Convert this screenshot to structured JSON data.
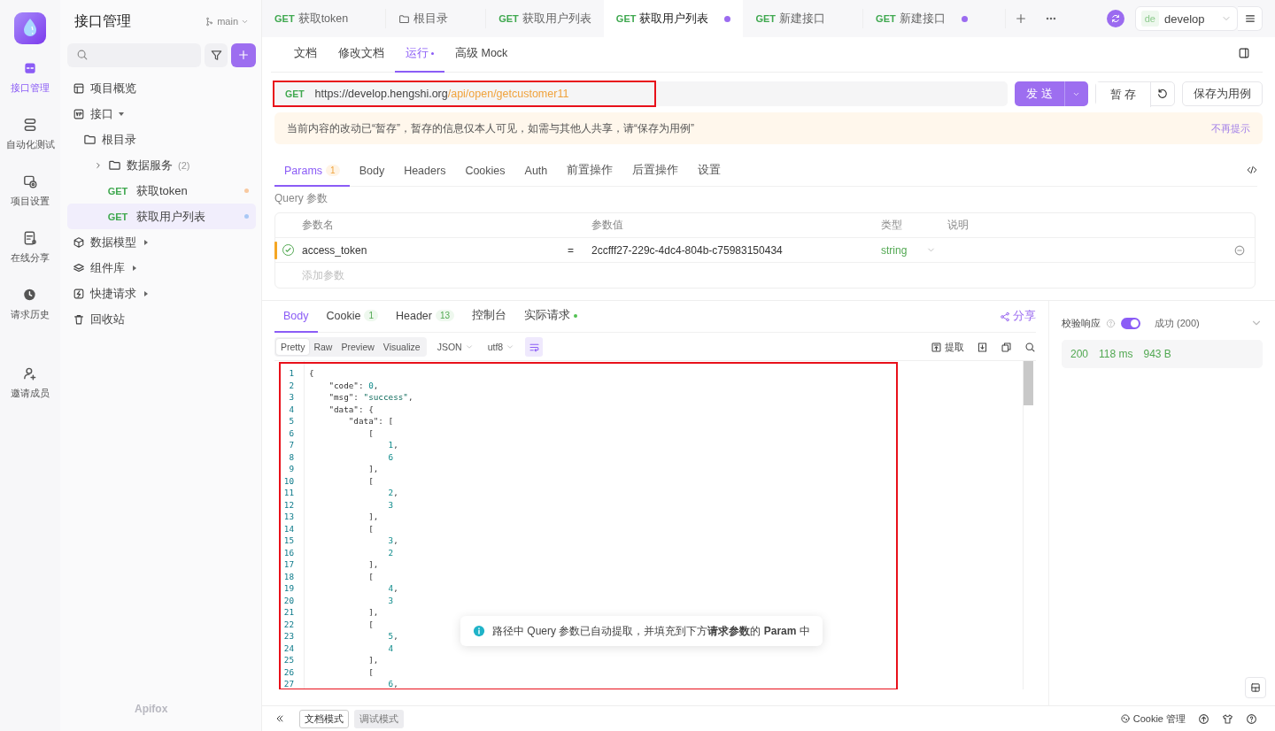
{
  "rail": {
    "items": [
      {
        "label": "接口管理",
        "selected": true
      },
      {
        "label": "自动化测试",
        "selected": false
      },
      {
        "label": "项目设置",
        "selected": false
      },
      {
        "label": "在线分享",
        "selected": false
      },
      {
        "label": "请求历史",
        "selected": false
      },
      {
        "label": "邀请成员",
        "selected": false
      }
    ]
  },
  "sidebar": {
    "title": "接口管理",
    "branch": "main",
    "brand": "Apifox",
    "tree": [
      {
        "kind": "group",
        "label": "项目概览",
        "selected": false
      },
      {
        "kind": "group",
        "label": "接口",
        "selected": false,
        "expanded": true,
        "children": [
          {
            "kind": "folder",
            "label": "根目录",
            "selected": false,
            "children": [
              {
                "kind": "folder",
                "label": "数据服务",
                "count": "(2)",
                "selected": false,
                "expanded": false
              },
              {
                "kind": "request",
                "method": "GET",
                "label": "获取token",
                "selected": false,
                "color": "#f8c9a0"
              },
              {
                "kind": "request",
                "method": "GET",
                "label": "获取用户列表",
                "selected": true,
                "color": "#a9c8f5"
              }
            ]
          }
        ]
      },
      {
        "kind": "group",
        "label": "数据模型",
        "selected": false,
        "expanded": false
      },
      {
        "kind": "group",
        "label": "组件库",
        "selected": false,
        "expanded": false
      },
      {
        "kind": "group",
        "label": "快捷请求",
        "selected": false,
        "expanded": false
      },
      {
        "kind": "group",
        "label": "回收站",
        "selected": false
      }
    ]
  },
  "tabs": [
    {
      "kind": "request",
      "method": "GET",
      "label": "获取token",
      "selected": false,
      "modified": false
    },
    {
      "kind": "folder",
      "label": "根目录",
      "selected": false,
      "modified": false
    },
    {
      "kind": "request",
      "method": "GET",
      "label": "获取用户列表",
      "selected": false,
      "modified": false
    },
    {
      "kind": "request",
      "method": "GET",
      "label": "获取用户列表",
      "selected": true,
      "modified": true
    },
    {
      "kind": "request",
      "method": "GET",
      "label": "新建接口",
      "selected": false,
      "modified": false
    },
    {
      "kind": "request",
      "method": "GET",
      "label": "新建接口",
      "selected": false,
      "modified": true
    }
  ],
  "environment": {
    "badge": "de",
    "name": "develop"
  },
  "subtabs": [
    {
      "label": "文档",
      "selected": false,
      "modified": false
    },
    {
      "label": "修改文档",
      "selected": false,
      "modified": false
    },
    {
      "label": "运行",
      "selected": true,
      "modified": true
    },
    {
      "label": "高级 Mock",
      "selected": false,
      "modified": false
    }
  ],
  "request": {
    "method": "GET",
    "url_base": "https://develop.hengshi.org",
    "url_path": "/api/open/getcustomer11",
    "highlighted": true,
    "send": "发 送",
    "save_temp": "暂 存",
    "save_case": "保存为用例"
  },
  "notice": {
    "text": "当前内容的改动已“暂存”，暂存的信息仅本人可见，如需与其他人共享，请“保存为用例”",
    "dismiss": "不再提示"
  },
  "param_tabs": [
    {
      "label": "Params",
      "count": "1",
      "selected": true
    },
    {
      "label": "Body",
      "selected": false
    },
    {
      "label": "Headers",
      "selected": false
    },
    {
      "label": "Cookies",
      "selected": false
    },
    {
      "label": "Auth",
      "selected": false
    },
    {
      "label": "前置操作",
      "selected": false
    },
    {
      "label": "后置操作",
      "selected": false
    },
    {
      "label": "设置",
      "selected": false
    }
  ],
  "query": {
    "label": "Query 参数",
    "columns": [
      "参数名",
      "参数值",
      "类型",
      "说明"
    ],
    "rows": [
      {
        "enabled": true,
        "name": "access_token",
        "operator": "=",
        "value": "2ccfff27-229c-4dc4-804b-c75983150434",
        "type": "string"
      }
    ],
    "add_placeholder": "添加参数"
  },
  "response_tabs": [
    {
      "label": "Body",
      "selected": true
    },
    {
      "label": "Cookie",
      "count": "1",
      "selected": false
    },
    {
      "label": "Header",
      "count": "13",
      "selected": false
    },
    {
      "label": "控制台",
      "selected": false
    },
    {
      "label": "实际请求",
      "selected": false,
      "dot": true
    }
  ],
  "share": "分享",
  "view_modes": [
    {
      "label": "Pretty",
      "selected": true
    },
    {
      "label": "Raw",
      "selected": false
    },
    {
      "label": "Preview",
      "selected": false
    },
    {
      "label": "Visualize",
      "selected": false
    }
  ],
  "format": "JSON",
  "encoding": "utf8",
  "wrap": true,
  "extract": "提取",
  "code": {
    "highlighted": true,
    "lines": [
      {
        "no": "1",
        "text": "{"
      },
      {
        "no": "2",
        "text": "    \"code\": 0,"
      },
      {
        "no": "3",
        "text": "    \"msg\": \"success\","
      },
      {
        "no": "4",
        "text": "    \"data\": {"
      },
      {
        "no": "5",
        "text": "        \"data\": ["
      },
      {
        "no": "6",
        "text": "            ["
      },
      {
        "no": "7",
        "text": "                1,"
      },
      {
        "no": "8",
        "text": "                6"
      },
      {
        "no": "9",
        "text": "            ],"
      },
      {
        "no": "10",
        "text": "            ["
      },
      {
        "no": "11",
        "text": "                2,"
      },
      {
        "no": "12",
        "text": "                3"
      },
      {
        "no": "13",
        "text": "            ],"
      },
      {
        "no": "14",
        "text": "            ["
      },
      {
        "no": "15",
        "text": "                3,"
      },
      {
        "no": "16",
        "text": "                2"
      },
      {
        "no": "17",
        "text": "            ],"
      },
      {
        "no": "18",
        "text": "            ["
      },
      {
        "no": "19",
        "text": "                4,"
      },
      {
        "no": "20",
        "text": "                3"
      },
      {
        "no": "21",
        "text": "            ],"
      },
      {
        "no": "22",
        "text": "            ["
      },
      {
        "no": "23",
        "text": "                5,"
      },
      {
        "no": "24",
        "text": "                4"
      },
      {
        "no": "25",
        "text": "            ],"
      },
      {
        "no": "26",
        "text": "            ["
      },
      {
        "no": "27",
        "text": "                6,"
      }
    ]
  },
  "validation": {
    "label": "校验响应",
    "enabled": true,
    "result": "成功 (200)",
    "status": "200",
    "time": "118 ms",
    "size": "943 B"
  },
  "toast": "路径中 Query 参数已自动提取，并填充到下方**请求参数**的 **Param** 中",
  "bottom": {
    "modes": [
      {
        "label": "文档模式",
        "selected": true
      },
      {
        "label": "调试模式",
        "selected": false
      }
    ],
    "cookie": "Cookie 管理"
  }
}
